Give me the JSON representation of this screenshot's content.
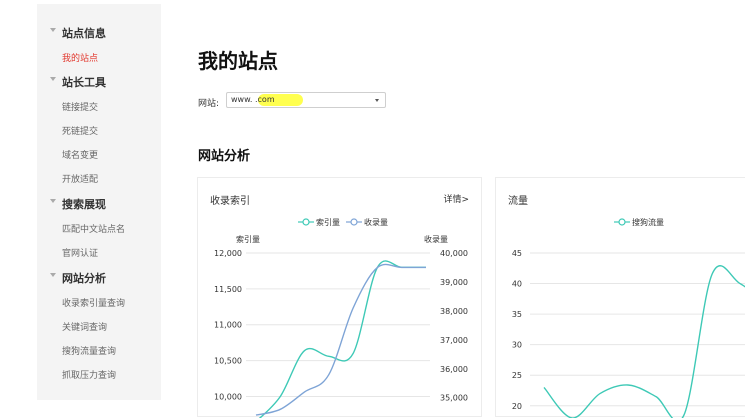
{
  "sidebar": {
    "groups": [
      {
        "title": "站点信息",
        "items": [
          {
            "label": "我的站点",
            "active": true
          }
        ]
      },
      {
        "title": "站长工具",
        "items": [
          {
            "label": "链接提交"
          },
          {
            "label": "死链提交"
          },
          {
            "label": "域名变更"
          },
          {
            "label": "开放适配"
          }
        ]
      },
      {
        "title": "搜索展现",
        "items": [
          {
            "label": "匹配中文站点名"
          },
          {
            "label": "官网认证"
          }
        ]
      },
      {
        "title": "网站分析",
        "items": [
          {
            "label": "收录索引量查询"
          },
          {
            "label": "关键词查询"
          },
          {
            "label": "搜狗流量查询"
          },
          {
            "label": "抓取压力查询"
          }
        ]
      }
    ]
  },
  "main": {
    "title": "我的站点",
    "site_label": "网站:",
    "site_value": "www.          .com",
    "section_title": "网站分析"
  },
  "colors": {
    "accent": "#e2382e",
    "series_index": "#3ec9b6",
    "series_included": "#7ea4d6",
    "series_traffic": "#3ec9b6"
  },
  "chart_data": [
    {
      "type": "line",
      "title": "收录索引",
      "detail_link": "详情>",
      "legend_position": "top-center",
      "grid": true,
      "y_left_label": "索引量",
      "y_right_label": "收录量",
      "y_left_ticks": [
        "12,000",
        "11,500",
        "11,000",
        "10,500",
        "10,000"
      ],
      "y_right_ticks": [
        "40,000",
        "39,000",
        "38,000",
        "37,000",
        "36,000",
        "35,000"
      ],
      "ylim_left": [
        9700,
        12000
      ],
      "ylim_right": [
        34300,
        40000
      ],
      "x": [
        0,
        1,
        2,
        3,
        4,
        5,
        6,
        7
      ],
      "series": [
        {
          "name": "索引量",
          "axis": "left",
          "values": [
            9650,
            10000,
            10640,
            10560,
            10600,
            11800,
            11800,
            11800
          ]
        },
        {
          "name": "收录量",
          "axis": "right",
          "values": [
            34400,
            34600,
            35200,
            35800,
            38100,
            39500,
            39500,
            39500
          ]
        }
      ]
    },
    {
      "type": "line",
      "title": "流量",
      "legend_position": "top-center",
      "grid": true,
      "y_ticks": [
        "45",
        "40",
        "35",
        "30",
        "25",
        "20"
      ],
      "ylim": [
        18,
        45
      ],
      "x": [
        0,
        1,
        2,
        3,
        4,
        5,
        6,
        7,
        8
      ],
      "series": [
        {
          "name": "搜狗流量",
          "values": [
            23,
            18,
            22,
            23.4,
            21.5,
            18.5,
            41.5,
            40,
            36.5
          ]
        }
      ]
    }
  ]
}
